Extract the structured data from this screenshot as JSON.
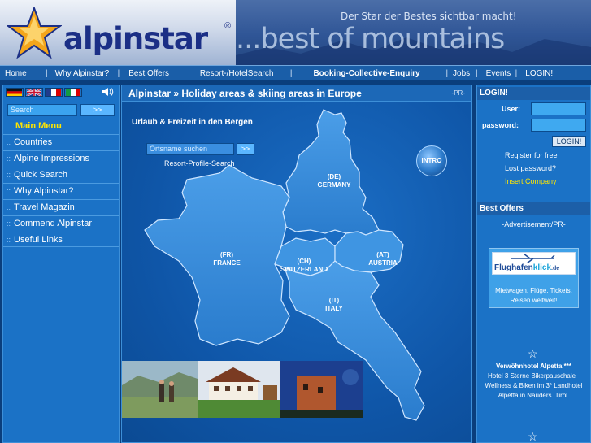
{
  "banner": {
    "logo_text": "alpinstar",
    "registered": "®",
    "slogan": "Der Star der Bestes sichtbar macht!",
    "tagline": "...best of mountains"
  },
  "topnav": {
    "items": [
      "Home",
      "Why Alpinstar?",
      "Best Offers",
      "Resort-/HotelSearch",
      "Booking-Collective-Enquiry",
      "Jobs",
      "Events",
      "LOGIN!"
    ],
    "separator": "|"
  },
  "sidebar": {
    "flags": [
      "german-flag",
      "uk-flag",
      "french-flag",
      "italian-flag"
    ],
    "search_placeholder": "Search",
    "search_button": ">>",
    "menu_title": "Main Menu",
    "bullet": "::",
    "items": [
      "Countries",
      "Alpine Impressions",
      "Quick Search",
      "Why Alpinstar?",
      "Travel Magazin",
      "Commend Alpinstar",
      "Useful Links"
    ]
  },
  "main": {
    "title": "Alpinstar » Holiday areas & skiing areas in Europe",
    "pr_label": "-PR-",
    "subtitle": "Urlaub & Freizeit in den Bergen",
    "place_placeholder": "Ortsname suchen",
    "place_button": ">>",
    "profile_link": "Resort-Profile-Search",
    "intro_button": "INTRO",
    "countries": [
      {
        "code": "(DE)",
        "name": "GERMANY"
      },
      {
        "code": "(FR)",
        "name": "FRANCE"
      },
      {
        "code": "(CH)",
        "name": "SWITZERLAND"
      },
      {
        "code": "(AT)",
        "name": "AUSTRIA"
      },
      {
        "code": "(IT)",
        "name": "ITALY"
      }
    ]
  },
  "rightbar": {
    "login_title": "LOGIN!",
    "user_label": "User:",
    "password_label": "password:",
    "login_button": "LOGIN!",
    "register": "Register for free",
    "lost_password": "Lost password?",
    "insert_company": "Insert Company",
    "offers_title": "Best Offers",
    "ad_label": "-Advertisement/PR-",
    "ad_brand_a": "Flughafen",
    "ad_brand_b": "klick",
    "ad_brand_c": ".de",
    "ad_text": "Mietwagen, Flüge, Tickets. Reisen weltweit!",
    "hotel_title": "Verwöhnhotel Alpetta ***",
    "hotel_text": "Hotel 3 Sterne Bikerpauschale · Wellness & Biken im 3* Landhotel Alpetta in Nauders. Tirol.",
    "colors": {
      "accent_yellow": "#ffe600",
      "panel_blue": "#1b72c6",
      "nav_blue": "#1a5ea8"
    }
  }
}
